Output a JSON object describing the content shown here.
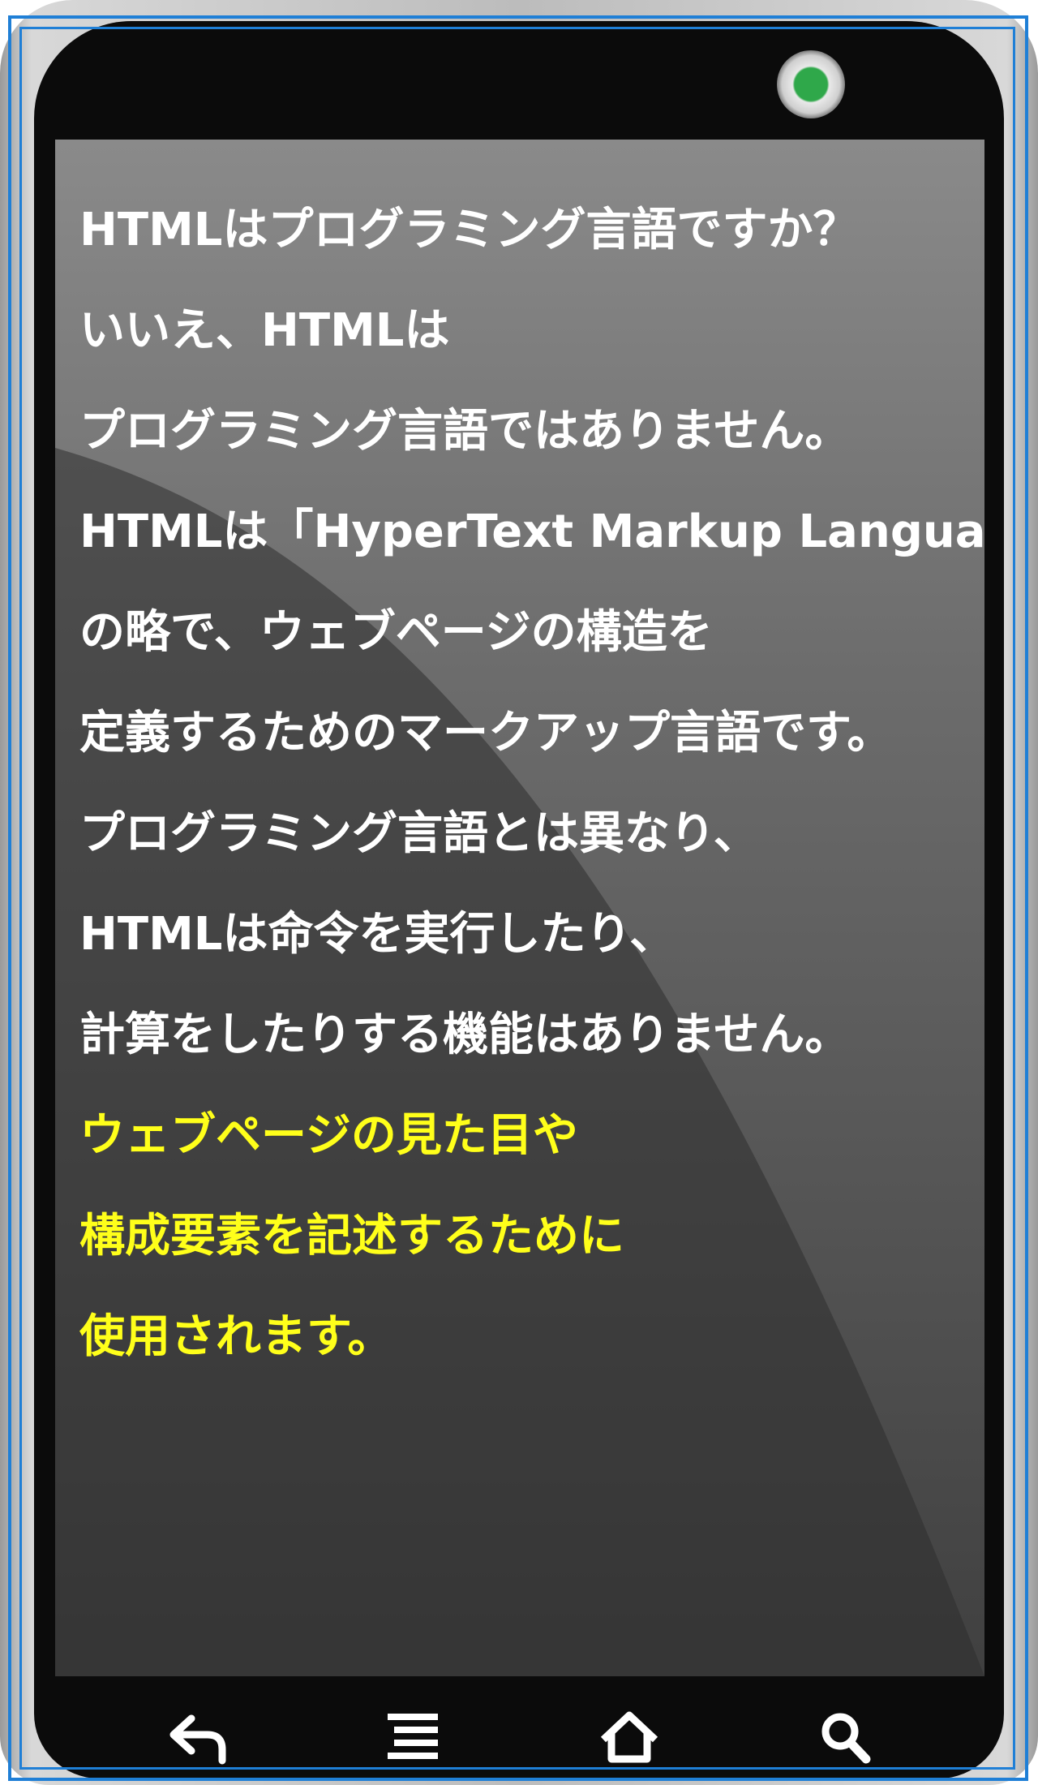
{
  "screen": {
    "lines": [
      "HTMLはプログラミング言語ですか？",
      "いいえ、HTMLは",
      "プログラミング言語ではありません。",
      "HTMLは「HyperText Markup Language」",
      "の略で、ウェブページの構造を",
      "定義するためのマークアップ言語です。",
      "プログラミング言語とは異なり、",
      "HTMLは命令を実行したり、",
      "計算をしたりする機能はありません。"
    ],
    "highlight_lines": [
      "ウェブページの見た目や",
      "構成要素を記述するために",
      "使用されます。"
    ]
  },
  "colors": {
    "text": "#ffffff",
    "highlight": "#ffff1a",
    "frame": "#1f7fd6",
    "led": "#2fa84a"
  },
  "navbar": {
    "icons": [
      "back-icon",
      "menu-icon",
      "home-icon",
      "search-icon"
    ]
  }
}
